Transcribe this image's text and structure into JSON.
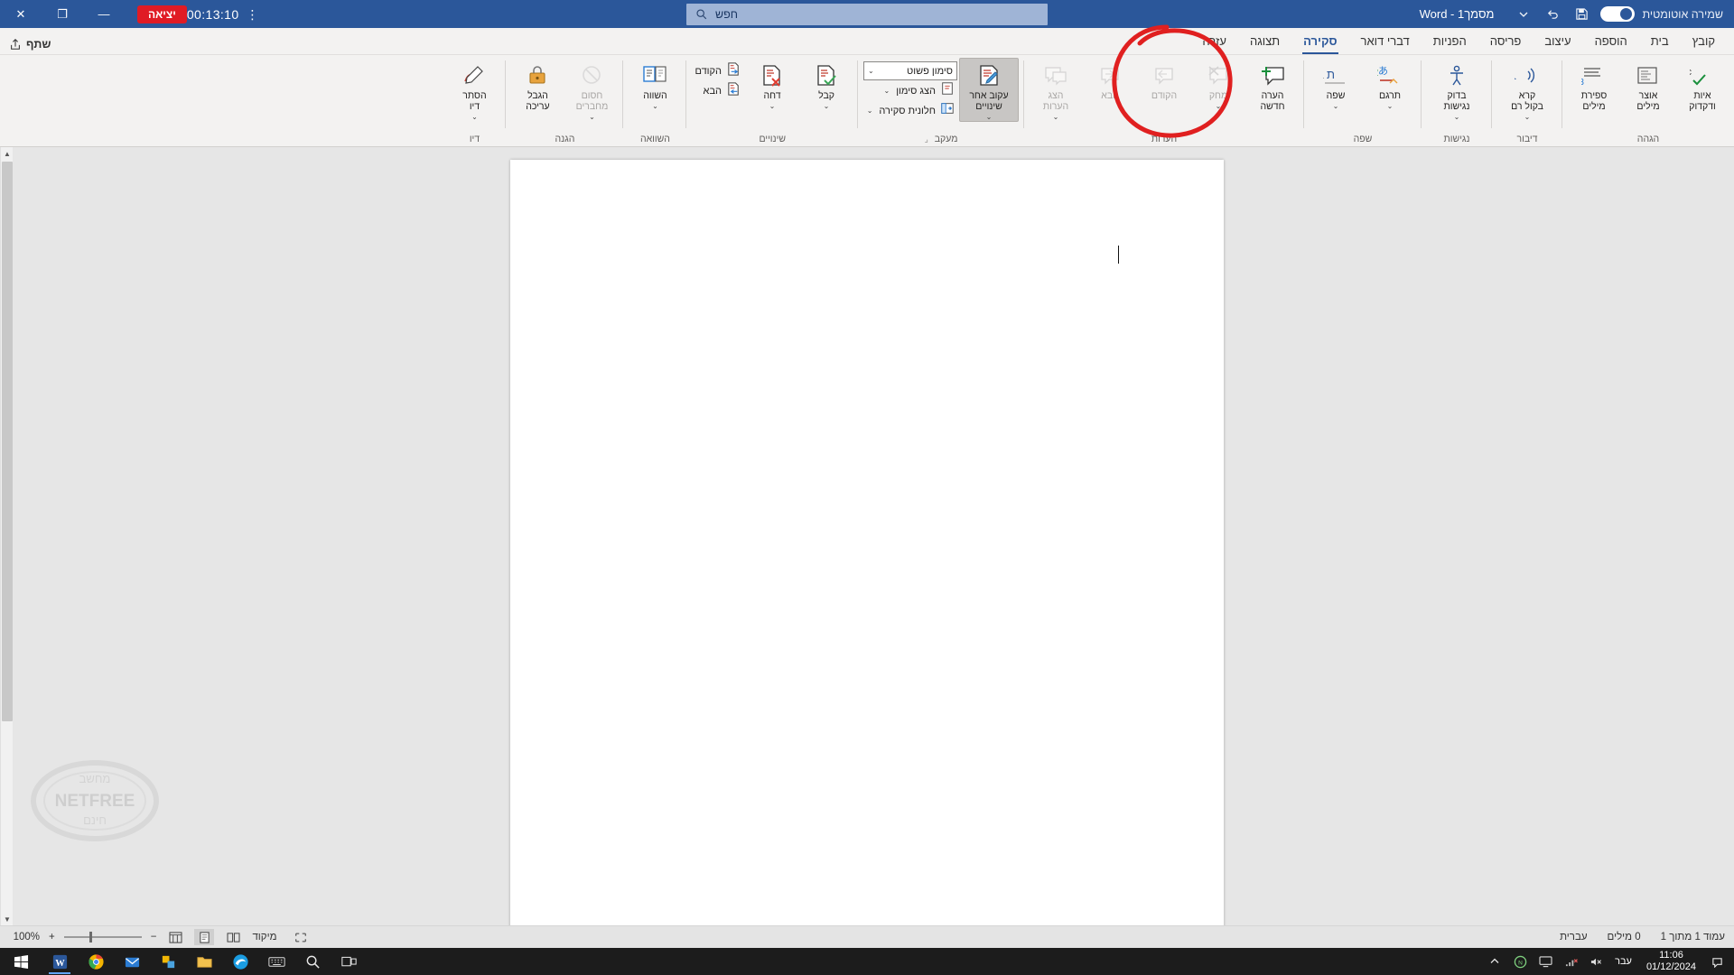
{
  "titlebar": {
    "autosave_label": "שמירה אוטומטית",
    "autosave_state": "off",
    "document_title": "מסמך1 - Word",
    "save_icon": "save-icon",
    "undo_icon": "undo-icon",
    "more_icon": "more-icon",
    "search_placeholder": "חפש",
    "search_icon": "search-icon",
    "close_label": "✕",
    "restore_label": "❐",
    "minimize_label": "—"
  },
  "recorder": {
    "exit_label": "יציאה",
    "timer": "00:13:10",
    "menu_icon": "kebab-menu-icon"
  },
  "tabs": [
    {
      "label": "קובץ",
      "active": false
    },
    {
      "label": "בית",
      "active": false
    },
    {
      "label": "הוספה",
      "active": false
    },
    {
      "label": "עיצוב",
      "active": false
    },
    {
      "label": "פריסה",
      "active": false
    },
    {
      "label": "הפניות",
      "active": false
    },
    {
      "label": "דברי דואר",
      "active": false
    },
    {
      "label": "סקירה",
      "active": true
    },
    {
      "label": "תצוגה",
      "active": false
    },
    {
      "label": "עזרה",
      "active": false
    }
  ],
  "share": {
    "label": "שתף",
    "icon": "share-icon"
  },
  "ribbon": {
    "groups": [
      {
        "name": "proofing",
        "label": "הגהה",
        "has_dialog_launcher": false,
        "buttons": [
          {
            "id": "spelling",
            "label": "איות\nודקדוק",
            "icon": "abc-check-icon",
            "disabled": false
          },
          {
            "id": "thesaurus",
            "label": "אוצר\nמילים",
            "icon": "thesaurus-icon",
            "disabled": false
          },
          {
            "id": "wordcount",
            "label": "ספירת\nמילים",
            "icon": "word-count-icon",
            "disabled": false
          }
        ]
      },
      {
        "name": "speech",
        "label": "דיבור",
        "buttons": [
          {
            "id": "read-aloud",
            "label": "קרא\nבקול רם",
            "icon": "read-aloud-icon",
            "disabled": false
          }
        ]
      },
      {
        "name": "accessibility",
        "label": "נגישות",
        "buttons": [
          {
            "id": "check-accessibility",
            "label": "בדוק\nנגישות",
            "icon": "accessibility-icon",
            "disabled": false
          }
        ]
      },
      {
        "name": "language",
        "label": "שפה",
        "buttons": [
          {
            "id": "translate",
            "label": "תרגם",
            "icon": "translate-icon",
            "disabled": false
          },
          {
            "id": "language",
            "label": "שפה",
            "icon": "language-icon",
            "disabled": false
          }
        ]
      },
      {
        "name": "comments",
        "label": "הערות",
        "buttons": [
          {
            "id": "new-comment",
            "label": "הערה\nחדשה",
            "icon": "new-comment-icon",
            "disabled": false
          },
          {
            "id": "delete-comment",
            "label": "מחק",
            "icon": "delete-comment-icon",
            "disabled": true
          },
          {
            "id": "previous-comment",
            "label": "הקודם",
            "icon": "previous-comment-icon",
            "disabled": true
          },
          {
            "id": "next-comment",
            "label": "הבא",
            "icon": "next-comment-icon",
            "disabled": true
          },
          {
            "id": "show-comments",
            "label": "הצג\nהערות",
            "icon": "show-comments-icon",
            "disabled": true
          }
        ]
      },
      {
        "name": "tracking",
        "label": "מעקב",
        "has_dialog_launcher": true,
        "track_changes": {
          "id": "track-changes",
          "label": "עקוב אחר\nשינויים",
          "icon": "track-changes-icon",
          "selected": true
        },
        "markup_display": {
          "id": "markup-display",
          "value": "סימון פשוט"
        },
        "show_markup": {
          "id": "show-markup",
          "label": "הצג סימון",
          "icon": "show-markup-icon"
        },
        "reviewing_pane": {
          "id": "reviewing-pane",
          "label": "חלונית סקירה",
          "icon": "reviewing-pane-icon"
        }
      },
      {
        "name": "changes",
        "label": "שינויים",
        "buttons": [
          {
            "id": "accept",
            "label": "קבל",
            "icon": "accept-change-icon",
            "disabled": false
          },
          {
            "id": "reject",
            "label": "דחה",
            "icon": "reject-change-icon",
            "disabled": false
          },
          {
            "id": "previous-change",
            "label": "הקודם",
            "icon": "previous-change-icon",
            "disabled": false
          },
          {
            "id": "next-change",
            "label": "הבא",
            "icon": "next-change-icon",
            "disabled": false
          }
        ]
      },
      {
        "name": "compare",
        "label": "השוואה",
        "buttons": [
          {
            "id": "compare",
            "label": "השווה",
            "icon": "compare-icon",
            "disabled": false
          }
        ]
      },
      {
        "name": "protect",
        "label": "הגנה",
        "buttons": [
          {
            "id": "block-authors",
            "label": "חסום\nמחברים",
            "icon": "block-authors-icon",
            "disabled": true
          },
          {
            "id": "restrict-editing",
            "label": "הגבל\nעריכה",
            "icon": "restrict-editing-icon",
            "disabled": false
          }
        ]
      },
      {
        "name": "ink",
        "label": "דיו",
        "buttons": [
          {
            "id": "hide-ink",
            "label": "הסתר\nדיו",
            "icon": "hide-ink-icon",
            "disabled": false
          }
        ]
      }
    ]
  },
  "document": {
    "page_background": "#ffffff",
    "cursor_visible": true,
    "watermark_text_top": "מחשב",
    "watermark_text_mid": "NETFREE",
    "watermark_text_bottom": "חינם"
  },
  "statusbar": {
    "page_info": "עמוד 1 מתוך 1",
    "word_count": "0 מילים",
    "language": "עברית",
    "focus_label": "מיקוד",
    "zoom_level": "100%",
    "zoom_out": "−",
    "zoom_in": "+",
    "view_read": "read-mode-icon",
    "view_print": "print-layout-icon",
    "view_web": "web-layout-icon"
  },
  "taskbar": {
    "start_icon": "windows-start-icon",
    "search_icon": "search-icon",
    "apps": [
      {
        "name": "word-taskbar-icon",
        "active": true
      },
      {
        "name": "chrome-taskbar-icon",
        "active": false
      },
      {
        "name": "mail-taskbar-icon",
        "active": false
      },
      {
        "name": "sticky-notes-taskbar-icon",
        "active": false
      },
      {
        "name": "file-explorer-taskbar-icon",
        "active": false
      },
      {
        "name": "edge-taskbar-icon",
        "active": false
      },
      {
        "name": "keyboard-taskbar-icon",
        "active": false
      },
      {
        "name": "magnifier-taskbar-icon",
        "active": false
      },
      {
        "name": "task-view-icon",
        "active": false
      }
    ],
    "tray": {
      "overflow_icon": "chevron-up-icon",
      "netfree_icon": "netfree-tray-icon",
      "monitor_icon": "monitor-tray-icon",
      "volume_icon": "volume-muted-icon",
      "network_icon": "network-error-icon",
      "keyboard_lang": "עבר",
      "time": "11:06",
      "date": "01/12/2024"
    }
  },
  "annotation": {
    "shape": "red-ellipse-highlight",
    "color": "#e02020",
    "target": "track-changes"
  }
}
